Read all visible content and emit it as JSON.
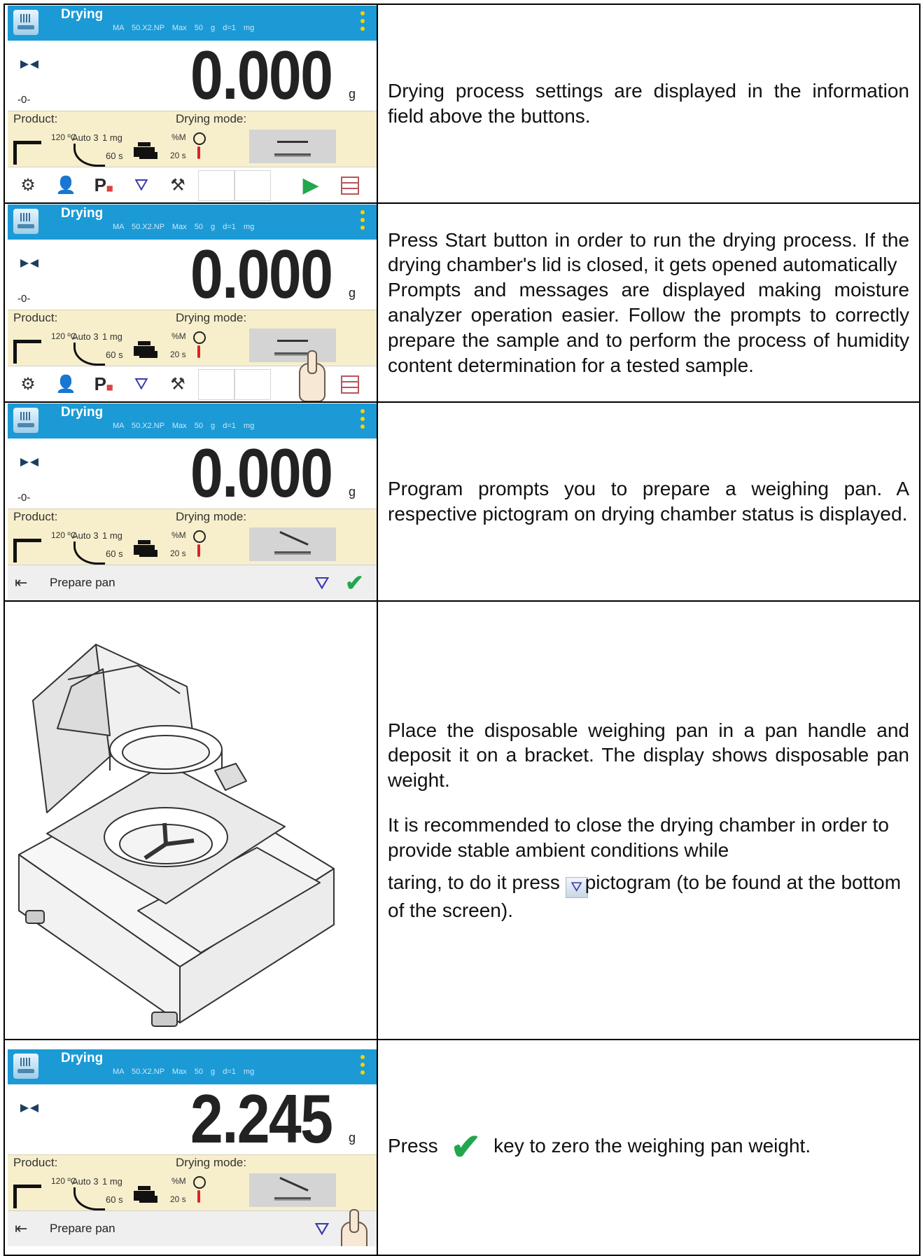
{
  "screens": [
    {
      "title": "Drying",
      "model": "MA 50.X2.NP",
      "max": "Max 50 g",
      "d": "d=1 mg",
      "reading": "0.000",
      "unit": "g",
      "zero": "-0-",
      "product": "Product:",
      "drying_mode": "Drying mode:",
      "temp": "120 ºC",
      "auto": "Auto 3",
      "mg": "1 mg",
      "time60": "60 s",
      "pm": "%M",
      "time20": "20 s",
      "bar": "buttons"
    },
    {
      "title": "Drying",
      "model": "MA 50.X2.NP",
      "max": "Max 50 g",
      "d": "d=1 mg",
      "reading": "0.000",
      "unit": "g",
      "zero": "-0-",
      "product": "Product:",
      "drying_mode": "Drying mode:",
      "temp": "120 ºC",
      "auto": "Auto 3",
      "mg": "1 mg",
      "time60": "60 s",
      "pm": "%M",
      "time20": "20 s",
      "bar": "buttons"
    },
    {
      "title": "Drying",
      "model": "MA 50.X2.NP",
      "max": "Max 50 g",
      "d": "d=1 mg",
      "reading": "0.000",
      "unit": "g",
      "zero": "-0-",
      "product": "Product:",
      "drying_mode": "Drying mode:",
      "temp": "120 ºC",
      "auto": "Auto 3",
      "mg": "1 mg",
      "time60": "60 s",
      "pm": "%M",
      "time20": "20 s",
      "bar": "message",
      "message": "Prepare pan"
    },
    {
      "title": "Drying",
      "model": "MA 50.X2.NP",
      "max": "Max 50 g",
      "d": "d=1 mg",
      "reading": "2.245",
      "unit": "g",
      "zero": "",
      "product": "Product:",
      "drying_mode": "Drying mode:",
      "temp": "120 ºC",
      "auto": "Auto 3",
      "mg": "1 mg",
      "time60": "60 s",
      "pm": "%M",
      "time20": "20 s",
      "bar": "message",
      "message": "Prepare pan"
    }
  ],
  "rows": [
    {
      "text": [
        "Drying process settings are displayed in the information field above the buttons."
      ]
    },
    {
      "text": [
        "Press Start button in order to run the drying process. If the drying chamber's lid is closed, it gets opened automatically",
        "Prompts and messages are displayed making moisture analyzer operation easier. Follow the prompts to correctly prepare the sample and to perform the process of humidity content determination for a tested sample."
      ]
    },
    {
      "text": [
        "Program prompts you to prepare a weighing pan. A respective pictogram on drying chamber status is displayed."
      ]
    },
    {
      "text": [
        "Place the disposable weighing pan in a pan handle and deposit it on a bracket. The display shows disposable pan weight.",
        "It is recommended to close the drying chamber in order to provide stable ambient conditions while",
        "taring, to do it press",
        "pictogram (to be found at the bottom of the screen)."
      ]
    },
    {
      "text": [
        "Press",
        "key to zero the weighing pan weight."
      ]
    }
  ]
}
